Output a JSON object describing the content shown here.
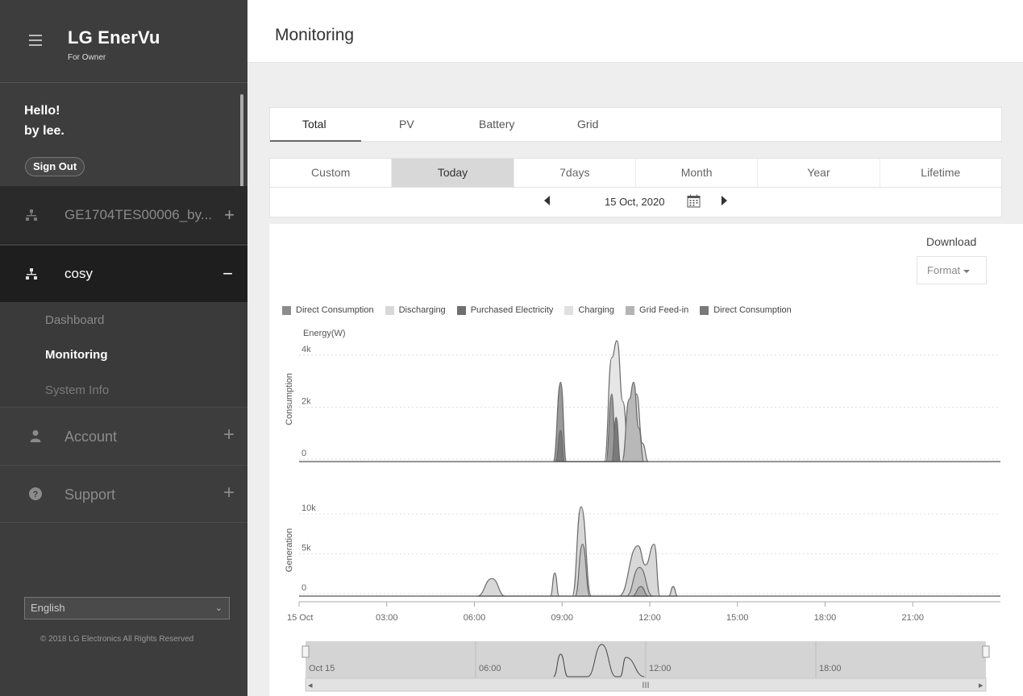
{
  "brand": {
    "name": "LG EnerVu",
    "sub": "For Owner"
  },
  "user": {
    "greeting": "Hello!",
    "name": "by lee.",
    "sign_out": "Sign Out"
  },
  "sites": [
    {
      "label": "GE1704TES00006_by...",
      "toggle": "+"
    },
    {
      "label": "cosy",
      "toggle": "−"
    }
  ],
  "submenu": [
    "Dashboard",
    "Monitoring",
    "System Info"
  ],
  "menu": {
    "account": "Account",
    "support": "Support",
    "plus": "+"
  },
  "language": "English",
  "copyright": "© 2018 LG Electronics All Rights Reserved",
  "page_title": "Monitoring",
  "tabs_primary": [
    "Total",
    "PV",
    "Battery",
    "Grid"
  ],
  "tabs_period": [
    "Custom",
    "Today",
    "7days",
    "Month",
    "Year",
    "Lifetime"
  ],
  "date": "15 Oct, 2020",
  "download": {
    "label": "Download",
    "format": "Format"
  },
  "colors": {
    "sidebar_bg": "#3d3d3d",
    "active_site_bg": "#1e1e1e",
    "active_tab": "#d8d8d8"
  },
  "icons": {
    "menu": "hamburger-icon",
    "site": "network-icon",
    "account": "user-icon",
    "support": "help-icon",
    "calendar": "calendar-icon"
  },
  "chart_data": {
    "type": "area",
    "legend": [
      {
        "name": "Direct Consumption",
        "color": "#8c8c8c"
      },
      {
        "name": "Discharging",
        "color": "#d8d8d8"
      },
      {
        "name": "Purchased Electricity",
        "color": "#6f6f6f"
      },
      {
        "name": "Charging",
        "color": "#e0e0e0"
      },
      {
        "name": "Grid Feed-in",
        "color": "#b4b4b4"
      },
      {
        "name": "Direct Consumption",
        "color": "#7a7a7a"
      }
    ],
    "y_unit": "Energy(W)",
    "panels": [
      {
        "title": "Consumption",
        "yticks": [
          {
            "v": 0,
            "label": "0"
          },
          {
            "v": 2000,
            "label": "2k"
          },
          {
            "v": 4000,
            "label": "4k"
          }
        ],
        "ylim": [
          0,
          4800
        ],
        "series": [
          {
            "color": "#e6e6e6",
            "points": [
              [
                10.45,
                0
              ],
              [
                10.7,
                4000
              ],
              [
                10.88,
                4650
              ],
              [
                11.08,
                2300
              ],
              [
                11.3,
                0
              ]
            ]
          },
          {
            "color": "#d8d8d8",
            "points": [
              [
                11.15,
                0
              ],
              [
                11.38,
                1800
              ],
              [
                11.55,
                2600
              ],
              [
                11.75,
                700
              ],
              [
                11.95,
                0
              ]
            ]
          },
          {
            "color": "#b8b8b8",
            "points": [
              [
                11.05,
                0
              ],
              [
                11.3,
                2400
              ],
              [
                11.45,
                3050
              ],
              [
                11.62,
                1300
              ],
              [
                11.8,
                0
              ]
            ]
          },
          {
            "color": "#9a9a9a",
            "points": [
              [
                8.7,
                0
              ],
              [
                8.95,
                3050
              ],
              [
                9.15,
                0
              ],
              [
                10.5,
                0
              ],
              [
                10.7,
                2600
              ],
              [
                10.85,
                0
              ]
            ]
          },
          {
            "color": "#7a7a7a",
            "points": [
              [
                8.78,
                0
              ],
              [
                8.95,
                1200
              ],
              [
                9.08,
                0
              ],
              [
                10.7,
                0
              ],
              [
                10.85,
                1700
              ],
              [
                11.0,
                0
              ]
            ]
          }
        ]
      },
      {
        "title": "Generation",
        "yticks": [
          {
            "v": 0,
            "label": "0"
          },
          {
            "v": 5000,
            "label": "5k"
          },
          {
            "v": 10000,
            "label": "10k"
          }
        ],
        "ylim": [
          0,
          11500
        ],
        "series": [
          {
            "color": "#d8d8d8",
            "points": [
              [
                6.1,
                0
              ],
              [
                6.6,
                2200
              ],
              [
                7.05,
                0
              ],
              [
                8.6,
                0
              ],
              [
                8.75,
                2900
              ],
              [
                8.9,
                0
              ],
              [
                9.35,
                0
              ],
              [
                9.65,
                11200
              ],
              [
                10.0,
                0
              ],
              [
                10.95,
                0
              ],
              [
                11.6,
                6300
              ],
              [
                11.85,
                3900
              ],
              [
                12.15,
                6500
              ],
              [
                12.35,
                0
              ],
              [
                12.65,
                0
              ],
              [
                12.8,
                1200
              ],
              [
                12.95,
                0
              ]
            ]
          },
          {
            "color": "#c4c4c4",
            "points": [
              [
                9.45,
                0
              ],
              [
                9.7,
                6500
              ],
              [
                9.95,
                0
              ],
              [
                11.2,
                0
              ],
              [
                11.65,
                3600
              ],
              [
                12.1,
                0
              ]
            ]
          },
          {
            "color": "#a8a8a8",
            "points": [
              [
                11.4,
                0
              ],
              [
                11.7,
                1200
              ],
              [
                11.95,
                0
              ]
            ]
          }
        ]
      }
    ],
    "x_ticks": [
      "15 Oct",
      "03:00",
      "06:00",
      "09:00",
      "12:00",
      "15:00",
      "18:00",
      "21:00"
    ],
    "navigator": {
      "labels": [
        "Oct 15",
        "06:00",
        "12:00",
        "18:00"
      ],
      "curve": [
        [
          8.75,
          0
        ],
        [
          9.0,
          70
        ],
        [
          9.25,
          0
        ],
        [
          9.95,
          0
        ],
        [
          10.45,
          100
        ],
        [
          10.95,
          0
        ],
        [
          11.1,
          0
        ],
        [
          11.3,
          60
        ],
        [
          11.95,
          0
        ]
      ]
    }
  }
}
